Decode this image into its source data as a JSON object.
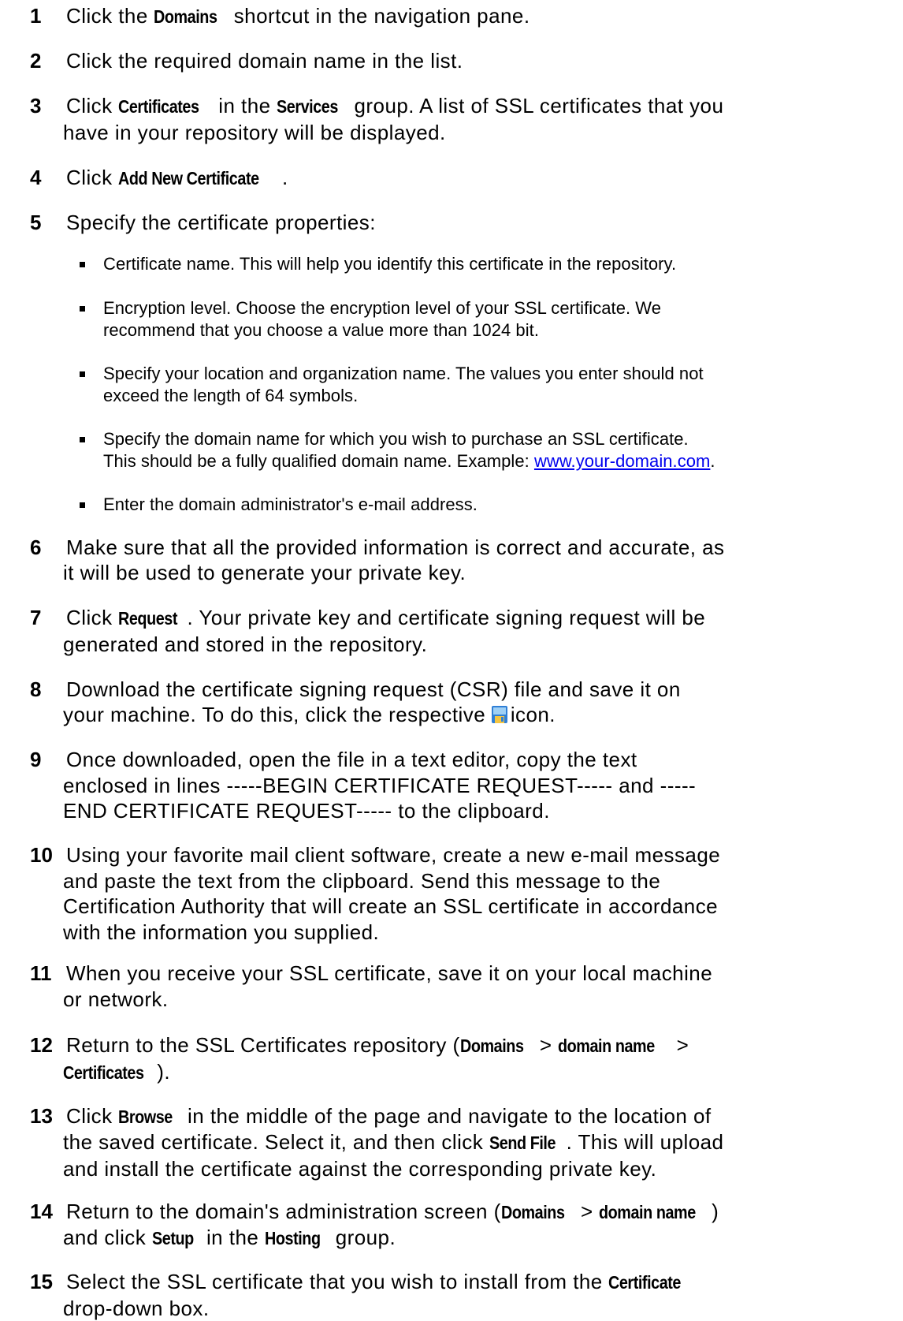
{
  "steps": [
    {
      "num": "1",
      "t1": "Click the ",
      "b1": "Domains",
      "t2": " shortcut in the navigation pane."
    },
    {
      "num": "2",
      "t1": "Click the required domain name in the list."
    },
    {
      "num": "3",
      "t1": "Click ",
      "b1": "Certificates",
      "t2": " in the ",
      "b2": "Services",
      "t3": " group. A list of SSL certificates that you",
      "l2": "have in your repository will be displayed."
    },
    {
      "num": "4",
      "t1": "Click ",
      "b1": "Add New Certificate",
      "t2": "."
    },
    {
      "num": "5",
      "t1": "Specify the certificate properties:"
    },
    {
      "num": "6",
      "l1": "Make sure that all the provided information is correct and accurate, as",
      "l2": "it will be used to generate your private key."
    },
    {
      "num": "7",
      "t1": "Click ",
      "b1": "Request",
      "t2": ". Your private key and certificate signing request will be",
      "l2": "generated and stored in the repository."
    },
    {
      "num": "8",
      "l1": "Download the certificate signing request (CSR) file and save it on",
      "l2a": "your machine. To do this, click the respective ",
      "l2b": "icon."
    },
    {
      "num": "9",
      "l1": "Once downloaded, open the file in a text editor, copy the text",
      "l2": "enclosed in lines -----BEGIN CERTIFICATE REQUEST----- and -----",
      "l3": "END CERTIFICATE REQUEST----- to the clipboard."
    },
    {
      "num": "10",
      "l1": "Using your favorite mail client software, create a new e-mail message",
      "l2": "and paste the text from the clipboard. Send this message to the",
      "l3": "Certification Authority that will create an SSL certificate in accordance",
      "l4": "with the information you supplied."
    },
    {
      "num": "11",
      "l1": "When you receive your SSL certificate, save it on your local machine",
      "l2": "or network."
    },
    {
      "num": "12",
      "t1": "Return to the SSL Certificates repository (",
      "b1": "Domains",
      "t2": " > ",
      "b2": "domain name",
      "t3": " >",
      "b3": "Certificates",
      "t4": ")."
    },
    {
      "num": "13",
      "t1": "Click ",
      "b1": "Browse",
      "t2": " in the middle of the page and navigate to the location of",
      "l2a": "the saved certificate. Select it, and then click ",
      "b2": "Send File",
      "l2b": ". This will upload",
      "l3": "and install the certificate against the corresponding private key."
    },
    {
      "num": "14",
      "t1": "Return to the domain's administration screen (",
      "b1": "Domains",
      "t2": " > ",
      "b2": "domain name",
      "t3": ")",
      "l2a": "and click ",
      "b3": "Setup",
      "l2b": " in the ",
      "b4": "Hosting",
      "l2c": " group."
    },
    {
      "num": "15",
      "t1": "Select the SSL certificate that you wish to install from the ",
      "b1": "Certificate",
      "l2": "drop-down box."
    }
  ],
  "bullets": [
    {
      "l1": "Certificate name. This will help you identify this certificate in the repository."
    },
    {
      "l1": "Encryption level. Choose the encryption level of your SSL certificate. We",
      "l2": "recommend that you choose a value more than 1024 bit."
    },
    {
      "l1": "Specify your location and organization name. The values you enter should not",
      "l2": "exceed the length of 64 symbols."
    },
    {
      "l1": "Specify the domain name for which you wish to purchase an SSL certificate.",
      "l2a": "This should be a fully qualified domain name. Example: ",
      "link": "www.your-domain.com",
      "l2b": "."
    },
    {
      "l1": "Enter the domain administrator's e-mail address."
    }
  ],
  "icons": {
    "save": "floppy-disk-save-icon"
  }
}
